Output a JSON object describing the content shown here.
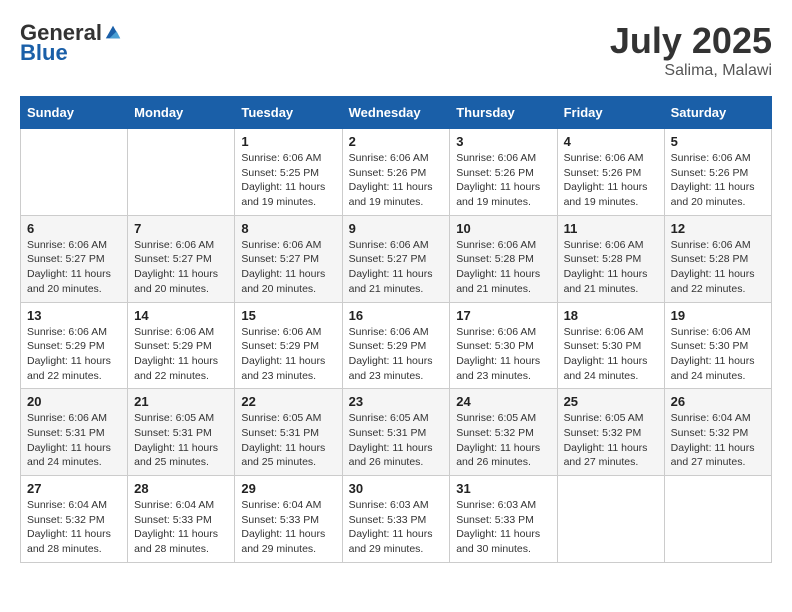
{
  "header": {
    "logo_general": "General",
    "logo_blue": "Blue",
    "month_year": "July 2025",
    "location": "Salima, Malawi"
  },
  "weekdays": [
    "Sunday",
    "Monday",
    "Tuesday",
    "Wednesday",
    "Thursday",
    "Friday",
    "Saturday"
  ],
  "weeks": [
    [
      {
        "day": "",
        "info": ""
      },
      {
        "day": "",
        "info": ""
      },
      {
        "day": "1",
        "info": "Sunrise: 6:06 AM\nSunset: 5:25 PM\nDaylight: 11 hours and 19 minutes."
      },
      {
        "day": "2",
        "info": "Sunrise: 6:06 AM\nSunset: 5:26 PM\nDaylight: 11 hours and 19 minutes."
      },
      {
        "day": "3",
        "info": "Sunrise: 6:06 AM\nSunset: 5:26 PM\nDaylight: 11 hours and 19 minutes."
      },
      {
        "day": "4",
        "info": "Sunrise: 6:06 AM\nSunset: 5:26 PM\nDaylight: 11 hours and 19 minutes."
      },
      {
        "day": "5",
        "info": "Sunrise: 6:06 AM\nSunset: 5:26 PM\nDaylight: 11 hours and 20 minutes."
      }
    ],
    [
      {
        "day": "6",
        "info": "Sunrise: 6:06 AM\nSunset: 5:27 PM\nDaylight: 11 hours and 20 minutes."
      },
      {
        "day": "7",
        "info": "Sunrise: 6:06 AM\nSunset: 5:27 PM\nDaylight: 11 hours and 20 minutes."
      },
      {
        "day": "8",
        "info": "Sunrise: 6:06 AM\nSunset: 5:27 PM\nDaylight: 11 hours and 20 minutes."
      },
      {
        "day": "9",
        "info": "Sunrise: 6:06 AM\nSunset: 5:27 PM\nDaylight: 11 hours and 21 minutes."
      },
      {
        "day": "10",
        "info": "Sunrise: 6:06 AM\nSunset: 5:28 PM\nDaylight: 11 hours and 21 minutes."
      },
      {
        "day": "11",
        "info": "Sunrise: 6:06 AM\nSunset: 5:28 PM\nDaylight: 11 hours and 21 minutes."
      },
      {
        "day": "12",
        "info": "Sunrise: 6:06 AM\nSunset: 5:28 PM\nDaylight: 11 hours and 22 minutes."
      }
    ],
    [
      {
        "day": "13",
        "info": "Sunrise: 6:06 AM\nSunset: 5:29 PM\nDaylight: 11 hours and 22 minutes."
      },
      {
        "day": "14",
        "info": "Sunrise: 6:06 AM\nSunset: 5:29 PM\nDaylight: 11 hours and 22 minutes."
      },
      {
        "day": "15",
        "info": "Sunrise: 6:06 AM\nSunset: 5:29 PM\nDaylight: 11 hours and 23 minutes."
      },
      {
        "day": "16",
        "info": "Sunrise: 6:06 AM\nSunset: 5:29 PM\nDaylight: 11 hours and 23 minutes."
      },
      {
        "day": "17",
        "info": "Sunrise: 6:06 AM\nSunset: 5:30 PM\nDaylight: 11 hours and 23 minutes."
      },
      {
        "day": "18",
        "info": "Sunrise: 6:06 AM\nSunset: 5:30 PM\nDaylight: 11 hours and 24 minutes."
      },
      {
        "day": "19",
        "info": "Sunrise: 6:06 AM\nSunset: 5:30 PM\nDaylight: 11 hours and 24 minutes."
      }
    ],
    [
      {
        "day": "20",
        "info": "Sunrise: 6:06 AM\nSunset: 5:31 PM\nDaylight: 11 hours and 24 minutes."
      },
      {
        "day": "21",
        "info": "Sunrise: 6:05 AM\nSunset: 5:31 PM\nDaylight: 11 hours and 25 minutes."
      },
      {
        "day": "22",
        "info": "Sunrise: 6:05 AM\nSunset: 5:31 PM\nDaylight: 11 hours and 25 minutes."
      },
      {
        "day": "23",
        "info": "Sunrise: 6:05 AM\nSunset: 5:31 PM\nDaylight: 11 hours and 26 minutes."
      },
      {
        "day": "24",
        "info": "Sunrise: 6:05 AM\nSunset: 5:32 PM\nDaylight: 11 hours and 26 minutes."
      },
      {
        "day": "25",
        "info": "Sunrise: 6:05 AM\nSunset: 5:32 PM\nDaylight: 11 hours and 27 minutes."
      },
      {
        "day": "26",
        "info": "Sunrise: 6:04 AM\nSunset: 5:32 PM\nDaylight: 11 hours and 27 minutes."
      }
    ],
    [
      {
        "day": "27",
        "info": "Sunrise: 6:04 AM\nSunset: 5:32 PM\nDaylight: 11 hours and 28 minutes."
      },
      {
        "day": "28",
        "info": "Sunrise: 6:04 AM\nSunset: 5:33 PM\nDaylight: 11 hours and 28 minutes."
      },
      {
        "day": "29",
        "info": "Sunrise: 6:04 AM\nSunset: 5:33 PM\nDaylight: 11 hours and 29 minutes."
      },
      {
        "day": "30",
        "info": "Sunrise: 6:03 AM\nSunset: 5:33 PM\nDaylight: 11 hours and 29 minutes."
      },
      {
        "day": "31",
        "info": "Sunrise: 6:03 AM\nSunset: 5:33 PM\nDaylight: 11 hours and 30 minutes."
      },
      {
        "day": "",
        "info": ""
      },
      {
        "day": "",
        "info": ""
      }
    ]
  ]
}
